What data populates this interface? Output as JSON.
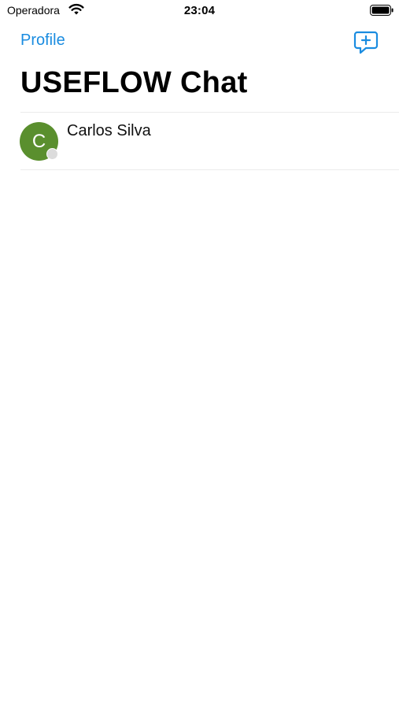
{
  "status_bar": {
    "carrier": "Operadora",
    "time": "23:04",
    "wifi_icon": "wifi-icon",
    "battery_icon": "battery-icon"
  },
  "nav": {
    "profile_label": "Profile",
    "compose_icon": "new-message-icon",
    "title": "USEFLOW Chat"
  },
  "colors": {
    "accent": "#1a8ce0",
    "avatar_green": "#5a8f2e",
    "presence_offline": "#dcdcdc"
  },
  "chats": [
    {
      "initial": "C",
      "name": "Carlos Silva",
      "avatar_color": "#5a8f2e",
      "status": "offline"
    }
  ]
}
